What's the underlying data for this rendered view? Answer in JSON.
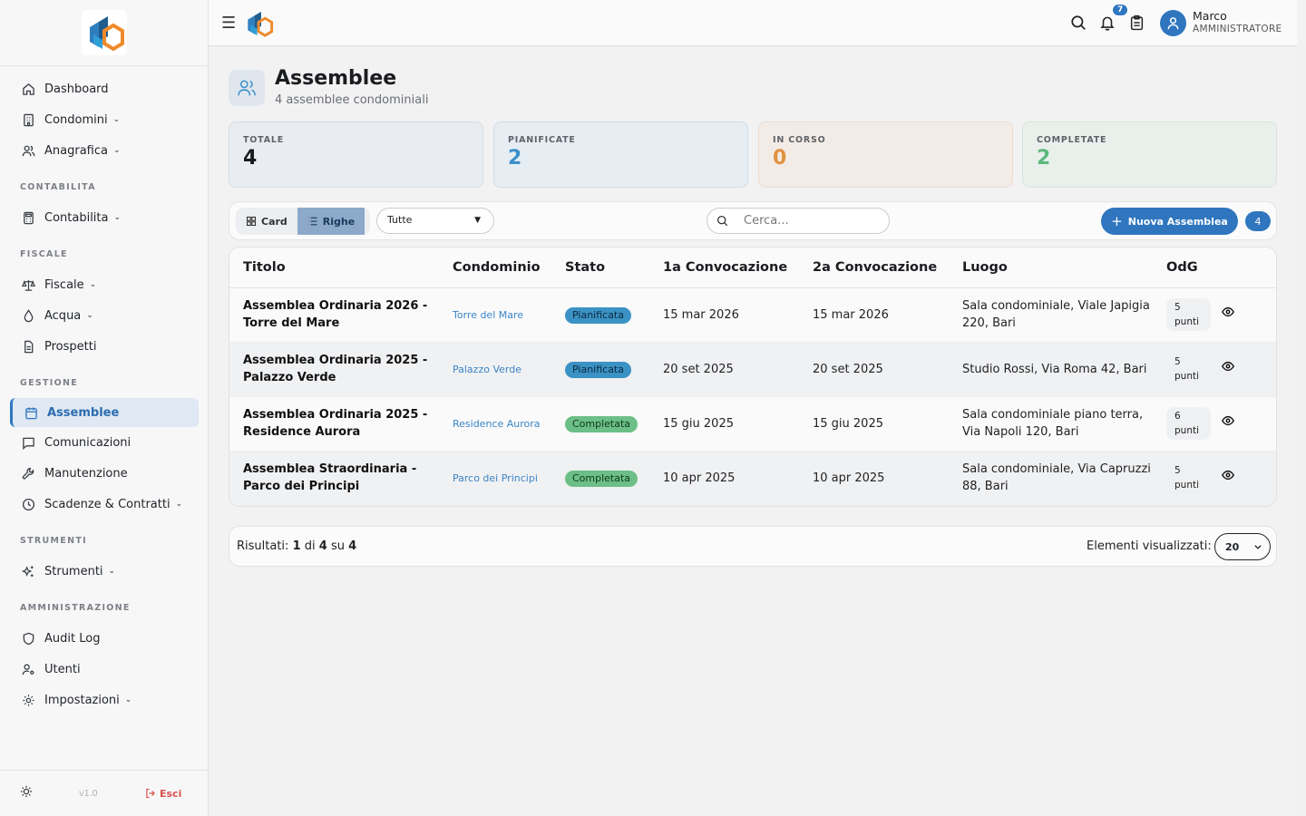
{
  "sidebar": {
    "items_top": [
      {
        "label": "Dashboard",
        "icon": "home-icon"
      },
      {
        "label": "Condomini",
        "icon": "building-icon",
        "chevron": true
      },
      {
        "label": "Anagrafica",
        "icon": "users-icon",
        "chevron": true
      }
    ],
    "sec_contabilita": "CONTABILITA",
    "contabilita": "Contabilita",
    "sec_fiscale": "FISCALE",
    "fiscale": "Fiscale",
    "acqua": "Acqua",
    "prospetti": "Prospetti",
    "sec_gestione": "GESTIONE",
    "assemblee": "Assemblee",
    "comunicazioni": "Comunicazioni",
    "manutenzione": "Manutenzione",
    "scadenze": "Scadenze & Contratti",
    "sec_strumenti": "STRUMENTI",
    "strumenti": "Strumenti",
    "sec_amministrazione": "AMMINISTRAZIONE",
    "audit": "Audit Log",
    "utenti": "Utenti",
    "impostazioni": "Impostazioni",
    "version": "v1.0",
    "logout": "Esci"
  },
  "topbar": {
    "notif_count": "7",
    "user_name": "Marco",
    "user_role": "AMMINISTRATORE"
  },
  "page": {
    "title": "Assemblee",
    "subtitle": "4 assemblee condominiali"
  },
  "stats": [
    {
      "label": "TOTALE",
      "value": "4"
    },
    {
      "label": "PIANIFICATE",
      "value": "2"
    },
    {
      "label": "IN CORSO",
      "value": "0"
    },
    {
      "label": "COMPLETATE",
      "value": "2"
    }
  ],
  "toolbar": {
    "view_card": "Card",
    "view_rows": "Righe",
    "filter_value": "Tutte",
    "search_placeholder": "Cerca...",
    "new_button": "Nuova Assemblea",
    "count": "4"
  },
  "table": {
    "headers": [
      "Titolo",
      "Condominio",
      "Stato",
      "1a Convocazione",
      "2a Convocazione",
      "Luogo",
      "OdG"
    ],
    "rows": [
      {
        "titolo": "Assemblea Ordinaria 2026 - Torre del Mare",
        "condominio": "Torre del Mare",
        "stato": "Pianificata",
        "conv1": "15 mar 2026",
        "conv2": "15 mar 2026",
        "luogo": "Sala condominiale, Viale Japigia 220, Bari",
        "odg_n": "5",
        "odg_u": "punti"
      },
      {
        "titolo": "Assemblea Ordinaria 2025 - Palazzo Verde",
        "condominio": "Palazzo Verde",
        "stato": "Pianificata",
        "conv1": "20 set 2025",
        "conv2": "20 set 2025",
        "luogo": "Studio Rossi, Via Roma 42, Bari",
        "odg_n": "5",
        "odg_u": "punti"
      },
      {
        "titolo": "Assemblea Ordinaria 2025 - Residence Aurora",
        "condominio": "Residence Aurora",
        "stato": "Completata",
        "conv1": "15 giu 2025",
        "conv2": "15 giu 2025",
        "luogo": "Sala condominiale piano terra, Via Napoli 120, Bari",
        "odg_n": "6",
        "odg_u": "punti"
      },
      {
        "titolo": "Assemblea Straordinaria - Parco dei Principi",
        "condominio": "Parco dei Principi",
        "stato": "Completata",
        "conv1": "10 apr 2025",
        "conv2": "10 apr 2025",
        "luogo": "Sala condominiale, Via Capruzzi 88, Bari",
        "odg_n": "5",
        "odg_u": "punti"
      }
    ]
  },
  "pagination": {
    "results_label": "Risultati:",
    "from": "1",
    "to": "4",
    "total": "4",
    "di": "di",
    "su": "su",
    "per_page_label": "Elementi visualizzati:",
    "per_page": "20"
  },
  "colors": {
    "accent": "#2f76bf",
    "pianificata": "#3b92c4",
    "completata": "#6cbf86",
    "in_corso": "#e19240"
  }
}
